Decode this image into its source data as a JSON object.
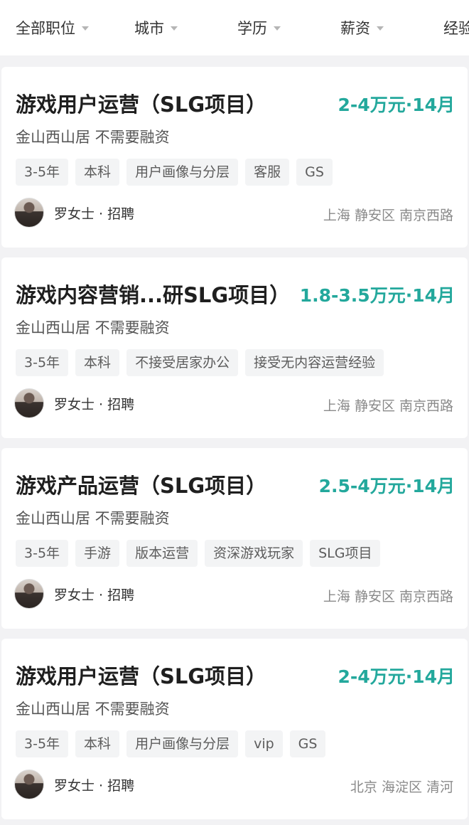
{
  "filters": [
    {
      "label": "全部职位"
    },
    {
      "label": "城市"
    },
    {
      "label": "学历"
    },
    {
      "label": "薪资"
    },
    {
      "label": "经验"
    }
  ],
  "jobs": [
    {
      "title": "游戏用户运营（SLG项目）",
      "salary": "2-4万元·14月",
      "company": "金山西山居 不需要融资",
      "tags": [
        "3-5年",
        "本科",
        "用户画像与分层",
        "客服",
        "GS"
      ],
      "recruiter": "罗女士 · 招聘",
      "location": "上海 静安区 南京西路"
    },
    {
      "title": "游戏内容营销...研SLG项目）",
      "salary": "1.8-3.5万元·14月",
      "company": "金山西山居 不需要融资",
      "tags": [
        "3-5年",
        "本科",
        "不接受居家办公",
        "接受无内容运营经验"
      ],
      "recruiter": "罗女士 · 招聘",
      "location": "上海 静安区 南京西路"
    },
    {
      "title": "游戏产品运营（SLG项目）",
      "salary": "2.5-4万元·14月",
      "company": "金山西山居 不需要融资",
      "tags": [
        "3-5年",
        "手游",
        "版本运营",
        "资深游戏玩家",
        "SLG项目"
      ],
      "recruiter": "罗女士 · 招聘",
      "location": "上海 静安区 南京西路"
    },
    {
      "title": "游戏用户运营（SLG项目）",
      "salary": "2-4万元·14月",
      "company": "金山西山居 不需要融资",
      "tags": [
        "3-5年",
        "本科",
        "用户画像与分层",
        "vip",
        "GS"
      ],
      "recruiter": "罗女士 · 招聘",
      "location": "北京 海淀区 清河"
    }
  ],
  "colors": {
    "salary": "#23a89c",
    "background": "#f2f2f4",
    "card": "#ffffff",
    "tag_bg": "#f3f4f5"
  }
}
